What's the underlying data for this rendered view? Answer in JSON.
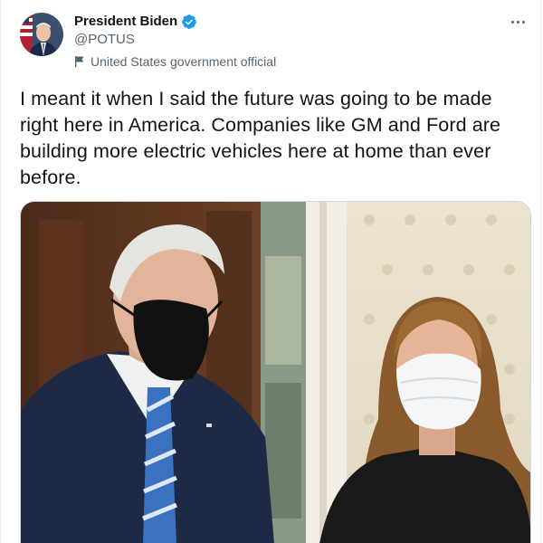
{
  "author": {
    "name": "President Biden",
    "handle": "@POTUS",
    "label": "United States government official",
    "verified": true,
    "accent_color": "#1d9bf0"
  },
  "tweet": {
    "text": "I meant it when I said the future was going to be made right here in America. Companies like GM and Ford are building more electric vehicles here at home than ever before."
  },
  "icons": {
    "verified": "verified-badge-icon",
    "label": "flag-icon",
    "menu": "more-options-icon"
  },
  "media": {
    "type": "photo",
    "description_visible": false
  }
}
